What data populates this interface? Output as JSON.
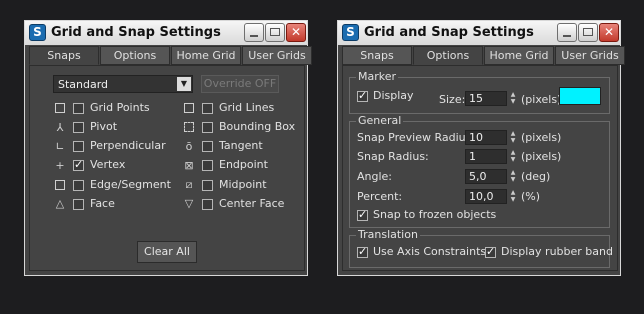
{
  "colors": {
    "background": "#1d1d1f",
    "panel": "#444444",
    "marker_color": "#00f2ff"
  },
  "left_window": {
    "title": "Grid and Snap Settings",
    "tabs": [
      "Snaps",
      "Options",
      "Home Grid",
      "User Grids"
    ],
    "active_tab": "Snaps",
    "snap_type_dropdown": "Standard",
    "override_button": "Override OFF",
    "snaps_left": [
      {
        "label": "Grid Points",
        "checked": false,
        "icon": "grid-points-icon"
      },
      {
        "label": "Pivot",
        "checked": false,
        "icon": "pivot-icon"
      },
      {
        "label": "Perpendicular",
        "checked": false,
        "icon": "perpendicular-icon"
      },
      {
        "label": "Vertex",
        "checked": true,
        "icon": "vertex-icon"
      },
      {
        "label": "Edge/Segment",
        "checked": false,
        "icon": "edge-segment-icon"
      },
      {
        "label": "Face",
        "checked": false,
        "icon": "face-icon"
      }
    ],
    "snaps_right": [
      {
        "label": "Grid Lines",
        "checked": false,
        "icon": "grid-lines-icon"
      },
      {
        "label": "Bounding Box",
        "checked": false,
        "icon": "bounding-box-icon"
      },
      {
        "label": "Tangent",
        "checked": false,
        "icon": "tangent-icon"
      },
      {
        "label": "Endpoint",
        "checked": false,
        "icon": "endpoint-icon"
      },
      {
        "label": "Midpoint",
        "checked": false,
        "icon": "midpoint-icon"
      },
      {
        "label": "Center Face",
        "checked": false,
        "icon": "center-face-icon"
      }
    ],
    "clear_all": "Clear All"
  },
  "right_window": {
    "title": "Grid and Snap Settings",
    "tabs": [
      "Snaps",
      "Options",
      "Home Grid",
      "User Grids"
    ],
    "active_tab": "Options",
    "marker": {
      "title": "Marker",
      "display_label": "Display",
      "display_checked": true,
      "size_label": "Size:",
      "size_value": "15",
      "size_unit": "(pixels)"
    },
    "general": {
      "title": "General",
      "snap_preview_radius_label": "Snap Preview Radius:",
      "snap_preview_radius_value": "10",
      "snap_preview_radius_unit": "(pixels)",
      "snap_radius_label": "Snap Radius:",
      "snap_radius_value": "1",
      "snap_radius_unit": "(pixels)",
      "angle_label": "Angle:",
      "angle_value": "5,0",
      "angle_unit": "(deg)",
      "percent_label": "Percent:",
      "percent_value": "10,0",
      "percent_unit": "(%)",
      "snap_frozen_label": "Snap to frozen objects",
      "snap_frozen_checked": true
    },
    "translation": {
      "title": "Translation",
      "axis_constraints_label": "Use Axis Constraints",
      "axis_constraints_checked": true,
      "rubber_band_label": "Display rubber band",
      "rubber_band_checked": true
    }
  }
}
